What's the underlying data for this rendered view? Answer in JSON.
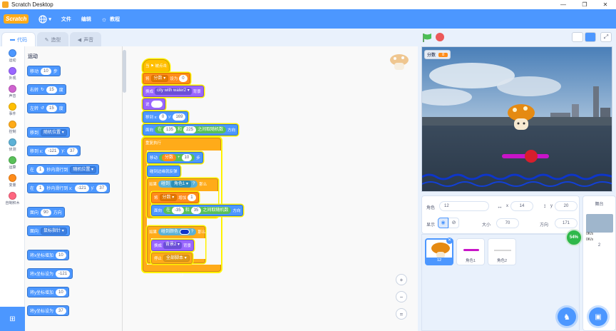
{
  "window": {
    "title": "Scratch Desktop",
    "min": "—",
    "max": "❐",
    "close": "✕"
  },
  "menubar": {
    "brand": "Scratch",
    "file": "文件",
    "edit": "编辑",
    "tutorials": "教程"
  },
  "tabs": {
    "code": "代码",
    "costumes": "造型",
    "sounds": "声音"
  },
  "categories": [
    {
      "label": "运动",
      "color": "#4c97ff"
    },
    {
      "label": "外观",
      "color": "#9966ff"
    },
    {
      "label": "声音",
      "color": "#cf63cf"
    },
    {
      "label": "事件",
      "color": "#ffbf00"
    },
    {
      "label": "控制",
      "color": "#ffab19"
    },
    {
      "label": "侦测",
      "color": "#5cb1d6"
    },
    {
      "label": "运算",
      "color": "#59c059"
    },
    {
      "label": "变量",
      "color": "#ff8c1a"
    },
    {
      "label": "自制积木",
      "color": "#ff6680"
    }
  ],
  "palette": {
    "heading": "运动",
    "move": {
      "a": "移动",
      "n": "10",
      "b": "步"
    },
    "turn_right": {
      "a": "右转",
      "n": "15",
      "b": "度"
    },
    "turn_left": {
      "a": "左转",
      "n": "15",
      "b": "度"
    },
    "goto": {
      "a": "移到",
      "dd": "随机位置"
    },
    "gotoxy": {
      "a": "移到 x:",
      "x": "-121",
      "b": "y:",
      "y": "37"
    },
    "glide": {
      "a": "在",
      "n": "1",
      "b": "秒内滑行到",
      "dd": "随机位置"
    },
    "glidexy": {
      "a": "在",
      "n": "1",
      "b": "秒内滑行到 x:",
      "x": "-121",
      "c": "y:",
      "y": "37"
    },
    "point": {
      "a": "面向",
      "n": "90",
      "b": "方向"
    },
    "pointto": {
      "a": "面向",
      "dd": "鼠标指针"
    },
    "changex": {
      "a": "将x坐标增加",
      "n": "10"
    },
    "setx": {
      "a": "将x坐标设为",
      "n": "-121"
    },
    "changey": {
      "a": "将y坐标增加",
      "n": "10"
    },
    "sety": {
      "a": "将y坐标设为",
      "n": "37"
    }
  },
  "script": {
    "hat": "当 ⚑ 被点击",
    "set1": {
      "a": "将",
      "v": "分数",
      "b": "设为",
      "n": "0"
    },
    "backdrop": {
      "a": "换成",
      "dd": "city with water2",
      "b": "背景"
    },
    "say": {
      "a": "说"
    },
    "gotoxy": {
      "a": "移到 x:",
      "x": "0",
      "b": "y:",
      "y": "169"
    },
    "pointrand": {
      "a": "面向",
      "a2": "在",
      "n1": "135",
      "b": "和",
      "n2": "225",
      "c": "之间取随机数",
      "d": "方向"
    },
    "forever": "重复执行",
    "move": {
      "a": "移动",
      "v": "分数",
      "op": "+",
      "n": "10",
      "b": "步"
    },
    "bounce": "碰到边缘就反弹",
    "if1": {
      "a": "如果",
      "b": "碰到",
      "dd": "角色1",
      "c": "?",
      "d": "那么"
    },
    "change": {
      "a": "将",
      "v": "分数",
      "b": "增加",
      "n": "1"
    },
    "pointrand2": {
      "a": "面向",
      "a2": "在",
      "n1": "-35",
      "b": "和",
      "n2": "35",
      "c": "之间取随机数",
      "d": "方向"
    },
    "if2": {
      "a": "如果",
      "b": "碰到颜色",
      "c": "?",
      "d": "那么"
    },
    "backdrop2": {
      "a": "换成",
      "dd": "背景2",
      "b": "背景"
    },
    "stop": {
      "a": "停止",
      "dd": "全部脚本"
    }
  },
  "zoom": {
    "in": "+",
    "out": "−",
    "reset": "="
  },
  "stage": {
    "monitor_label": "分数",
    "monitor_value": "8"
  },
  "sprite": {
    "label": "角色",
    "name": "12",
    "x_label": "x",
    "x": "14",
    "y_label": "y",
    "y": "20",
    "show_label": "显示",
    "size_label": "大小",
    "size": "70",
    "dir_label": "方向",
    "dir": "171"
  },
  "sprites": [
    {
      "name": "12"
    },
    {
      "name": "角色1"
    },
    {
      "name": "角色2"
    }
  ],
  "stagepanel": {
    "label": "舞台",
    "backdrops_count": "2"
  },
  "net": {
    "percent": "54%",
    "up": "0K/s",
    "down": "0K/s"
  }
}
